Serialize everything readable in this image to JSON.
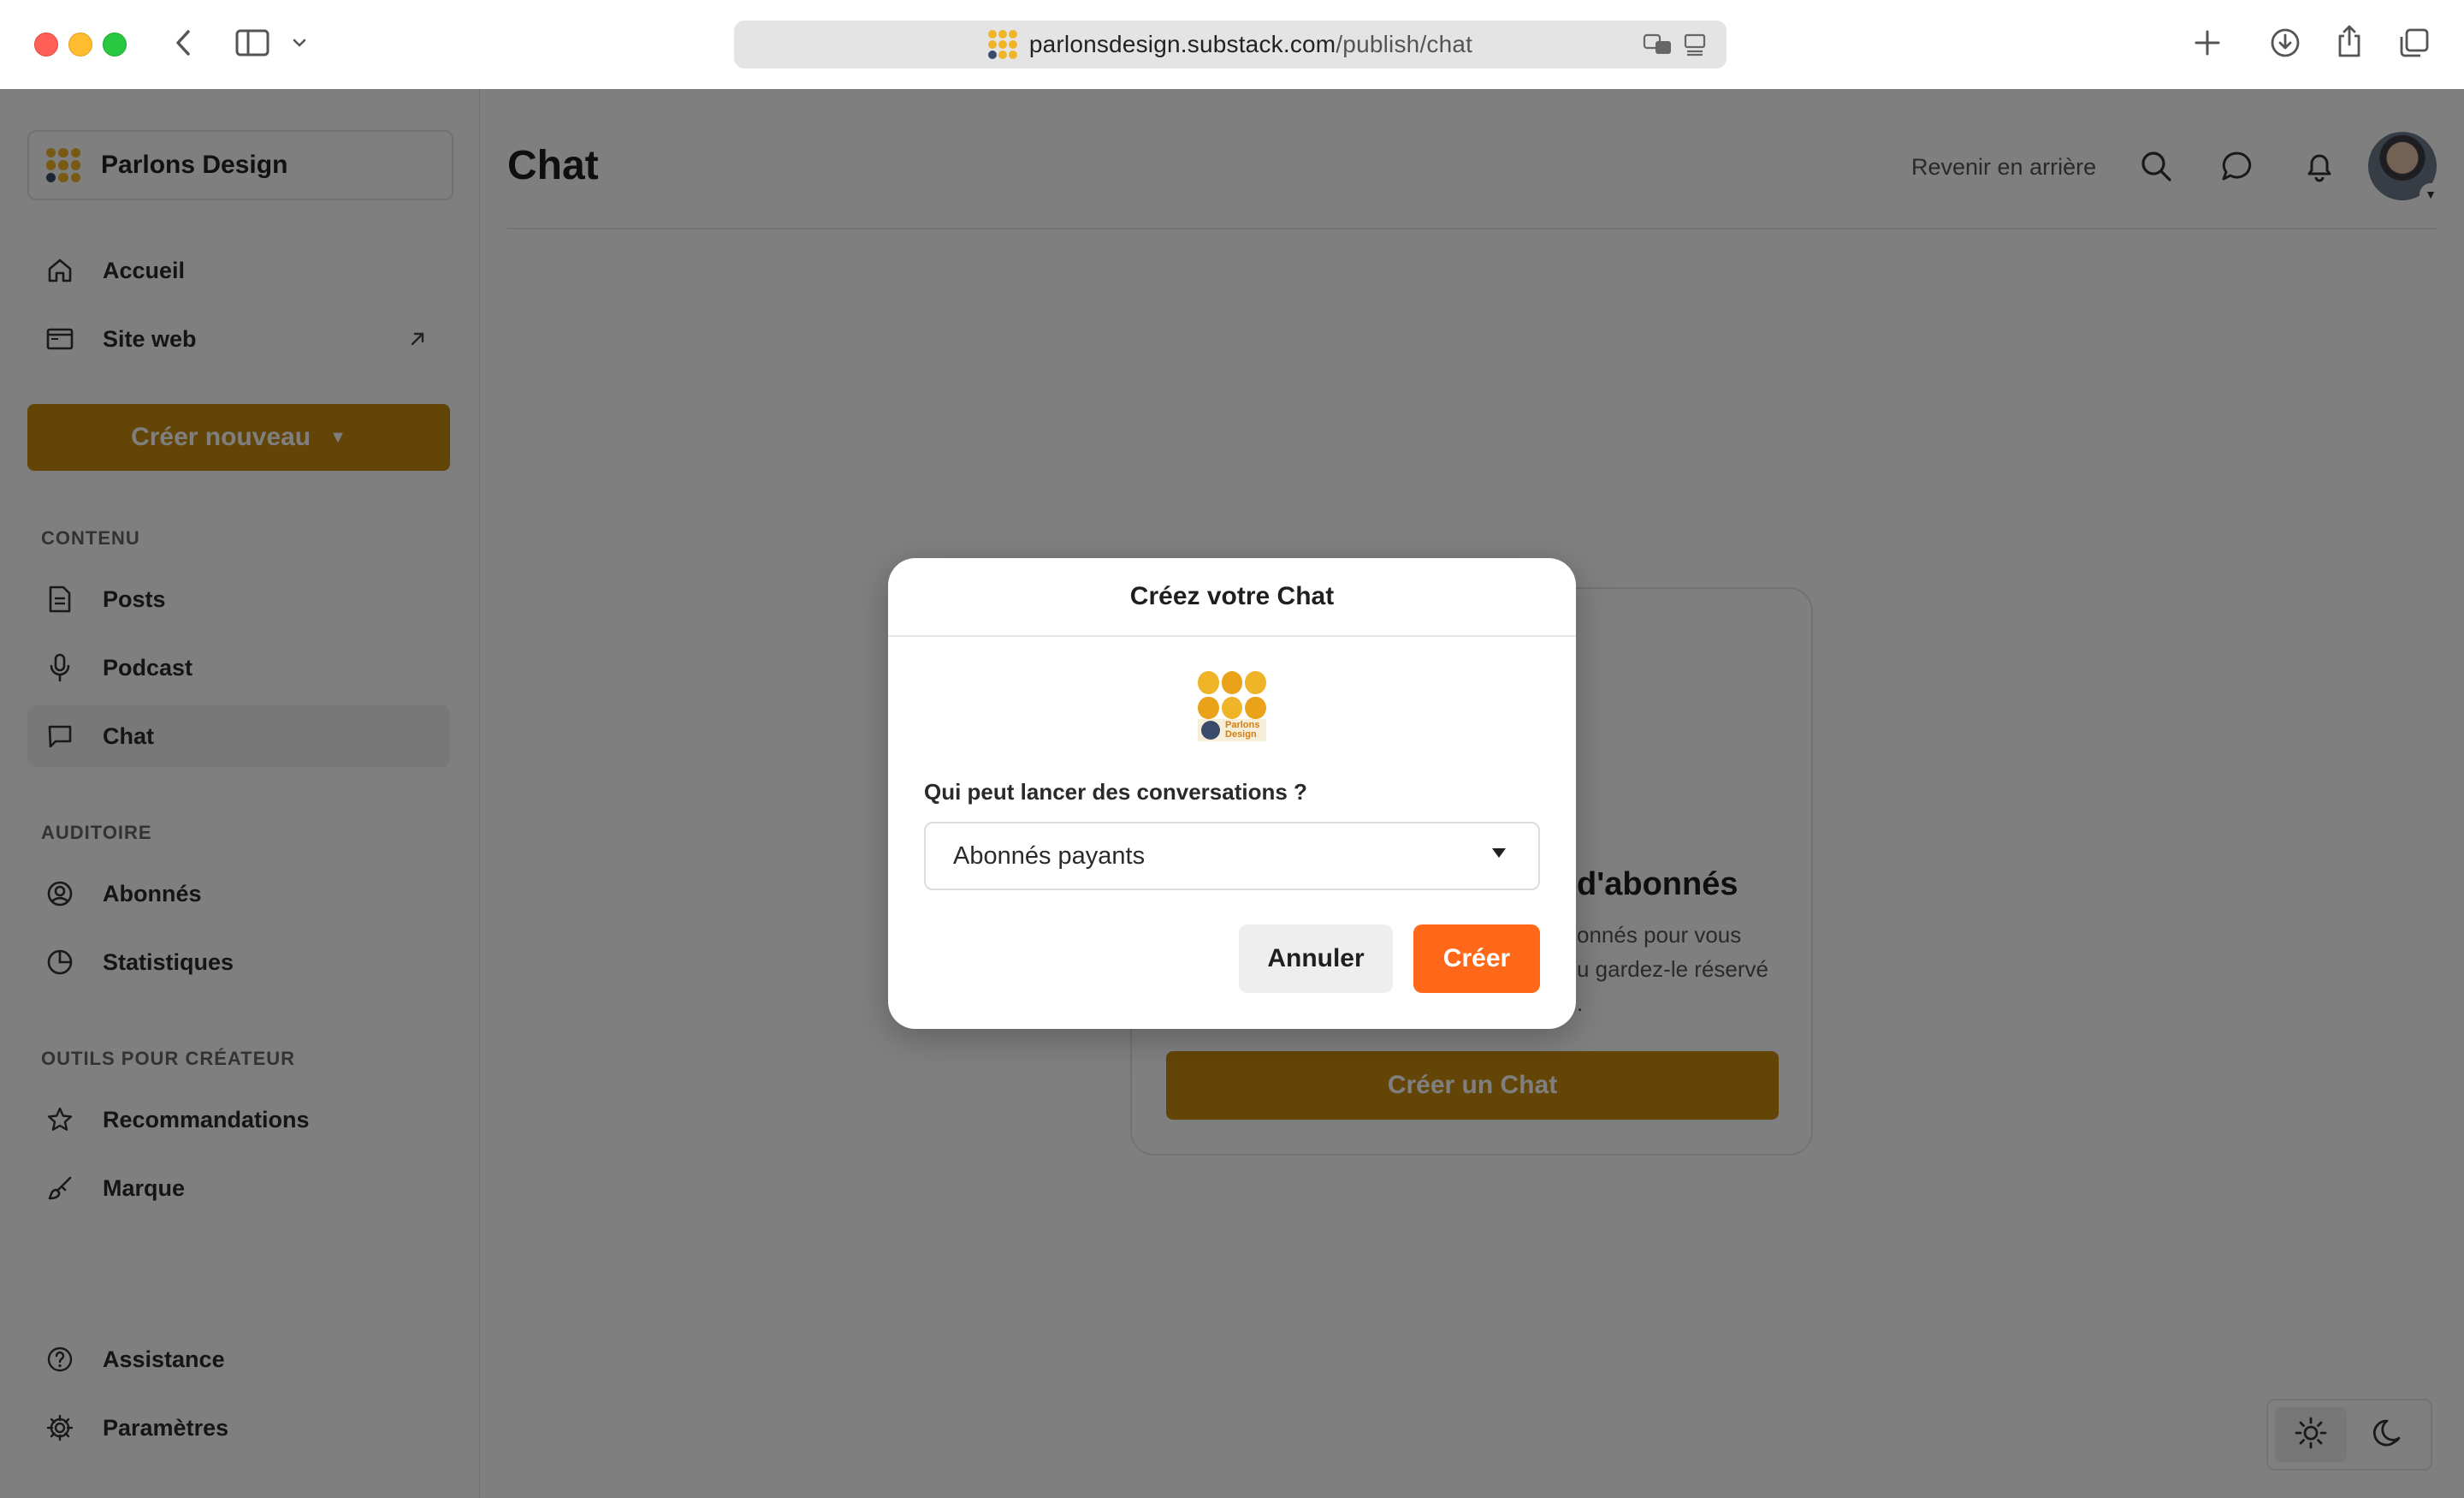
{
  "browser": {
    "url_host": "parlonsdesign.substack.com",
    "url_path": "/publish/chat",
    "icons": [
      "back-icon",
      "sidebar-toggle-icon",
      "chevron-down-icon",
      "translate-icon",
      "reader-icon",
      "new-tab-icon",
      "download-icon",
      "share-icon",
      "tabs-icon"
    ]
  },
  "sidebar": {
    "publication_name": "Parlons Design",
    "nav_top": [
      {
        "label": "Accueil",
        "icon": "home-icon"
      },
      {
        "label": "Site web",
        "icon": "browser-icon"
      }
    ],
    "create_label": "Créer nouveau",
    "sections": {
      "content_title": "CONTENU",
      "audience_title": "AUDITOIRE",
      "tools_title": "OUTILS POUR CRÉATEUR"
    },
    "content_items": [
      {
        "label": "Posts",
        "icon": "document-icon"
      },
      {
        "label": "Podcast",
        "icon": "microphone-icon"
      },
      {
        "label": "Chat",
        "icon": "chat-icon"
      }
    ],
    "audience_items": [
      {
        "label": "Abonnés",
        "icon": "user-circle-icon"
      },
      {
        "label": "Statistiques",
        "icon": "pie-chart-icon"
      }
    ],
    "tools_items": [
      {
        "label": "Recommandations",
        "icon": "star-icon"
      },
      {
        "label": "Marque",
        "icon": "brush-icon"
      }
    ],
    "bottom_items": [
      {
        "label": "Assistance",
        "icon": "help-icon"
      },
      {
        "label": "Paramètres",
        "icon": "gear-icon"
      }
    ]
  },
  "main": {
    "title": "Chat",
    "back_link": "Revenir en arrière",
    "empty_state": {
      "title_visible": "d'abonnés",
      "desc_line1": "onnés pour vous",
      "desc_line2": "u gardez-le réservé",
      "desc_line3": ".",
      "button": "Créer un Chat"
    }
  },
  "modal": {
    "title": "Créez votre Chat",
    "logo_text_line1": "Parlons",
    "logo_text_line2": "Design",
    "question": "Qui peut lancer des conversations ?",
    "selected_option": "Abonnés payants",
    "cancel": "Annuler",
    "create": "Créer"
  },
  "colors": {
    "accent_orange": "#ff6719",
    "brand_gold": "#c98a10",
    "overlay": "rgba(0,0,0,0.5)"
  }
}
